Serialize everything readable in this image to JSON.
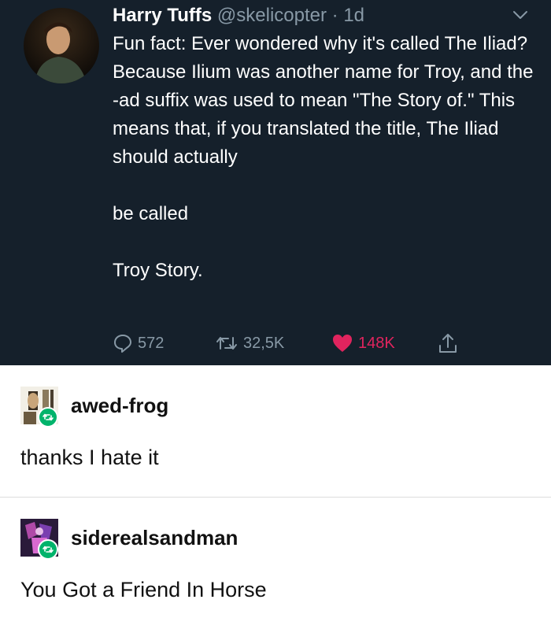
{
  "tweet": {
    "name": "Harry Tuffs",
    "handle": "@skelicopter",
    "time_sep": " · ",
    "time": "1d",
    "paragraphs": [
      "Fun fact: Ever wondered why it's called The Iliad? Because Ilium was another name for Troy, and the -ad suffix was used to mean \"The Story of.\" This means that, if you translated the title, The Iliad should actually",
      "be called",
      "Troy Story."
    ],
    "actions": {
      "reply_count": "572",
      "retweet_count": "32,5K",
      "like_count": "148K"
    },
    "colors": {
      "background": "#15202b",
      "muted": "#8899a6",
      "like": "#e0245e"
    }
  },
  "posts": [
    {
      "username": "awed-frog",
      "text": "thanks I hate it",
      "avatar_icon": "frog-avatar-icon",
      "badge_icon": "reblog-icon"
    },
    {
      "username": "siderealsandman",
      "text": "You Got a Friend In Horse",
      "avatar_icon": "purple-avatar-icon",
      "badge_icon": "reblog-icon"
    }
  ]
}
